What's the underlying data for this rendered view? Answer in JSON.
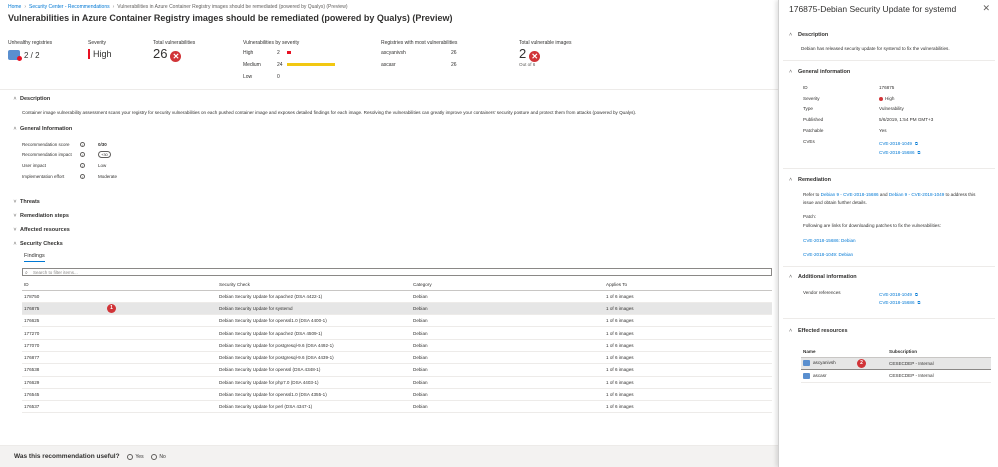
{
  "breadcrumb": {
    "items": [
      "Home",
      "Security Center - Recommendations",
      "Vulnerabilities in Azure Container Registry images should be remediated (powered by Qualys) (Preview)"
    ]
  },
  "page": {
    "title": "Vulnerabilities in Azure Container Registry images should be remediated (powered by Qualys) (Preview)",
    "more": "..."
  },
  "summary": {
    "unhealthy_label": "Unhealthy registries",
    "unhealthy_value": "2 / 2",
    "severity_label": "Severity",
    "severity_value": "High",
    "total_vuln_label": "Total vulnerabilities",
    "total_vuln_value": "26",
    "by_severity_label": "Vulnerabilities by severity",
    "by_severity": [
      {
        "label": "High",
        "count": "2",
        "fraction": 0.083,
        "color": "#e81123"
      },
      {
        "label": "Medium",
        "count": "24",
        "fraction": 1.0,
        "color": "#f2c811"
      },
      {
        "label": "Low",
        "count": "0",
        "fraction": 0,
        "color": "#8a8886"
      }
    ],
    "registries_label": "Registries with most vulnerabilities",
    "registries": [
      {
        "name": "ascyanivsh",
        "count": "26"
      },
      {
        "name": "ascasr",
        "count": "26"
      }
    ],
    "vuln_images_label": "Total vulnerable images",
    "vuln_images_value": "2",
    "vuln_images_sub": "Out of 6"
  },
  "sections": {
    "description": "Description",
    "description_text": "Container image vulnerability assessment scans your registry for security vulnerabilities on each pushed container image and exposes detailed findings for each image. Resolving the vulnerabilities can greatly improve your containers' security posture and protect them from attacks (powered by Qualys).",
    "general": "General Information",
    "threats": "Threats",
    "remediation": "Remediation steps",
    "affected": "Affected resources",
    "checks": "Security Checks"
  },
  "general_info": [
    {
      "label": "Recommendation score",
      "value": "0/30"
    },
    {
      "label": "Recommendation impact",
      "value": "+30"
    },
    {
      "label": "User impact",
      "value": "Low"
    },
    {
      "label": "Implementation effort",
      "value": "Moderate"
    }
  ],
  "findings": {
    "tab": "Findings",
    "filter_placeholder": "Search to filter items...",
    "columns": [
      "ID",
      "Security Check",
      "Category",
      "Applies To"
    ],
    "step_marker": "1",
    "rows": [
      {
        "id": "178750",
        "check": "Debian Security Update for apache2 (DSA 4422-1)",
        "category": "Debian",
        "applies": "1 of 6 images"
      },
      {
        "id": "176875",
        "check": "Debian Security Update for systemd",
        "category": "Debian",
        "applies": "1 of 6 images"
      },
      {
        "id": "176625",
        "check": "Debian Security Update for openssl1.0 (DSA 4400-1)",
        "category": "Debian",
        "applies": "1 of 6 images"
      },
      {
        "id": "177270",
        "check": "Debian Security Update for apache2 (DSA 4509-1)",
        "category": "Debian",
        "applies": "1 of 6 images"
      },
      {
        "id": "177070",
        "check": "Debian Security Update for postgresql-9.6 (DSA 4492-1)",
        "category": "Debian",
        "applies": "1 of 6 images"
      },
      {
        "id": "176877",
        "check": "Debian Security Update for postgresql-9.6 (DSA 4439-1)",
        "category": "Debian",
        "applies": "1 of 6 images"
      },
      {
        "id": "176538",
        "check": "Debian Security Update for openssl (DSA 4348-1)",
        "category": "Debian",
        "applies": "1 of 6 images"
      },
      {
        "id": "176629",
        "check": "Debian Security Update for php7.0 (DSA 4403-1)",
        "category": "Debian",
        "applies": "1 of 6 images"
      },
      {
        "id": "176545",
        "check": "Debian Security Update for openssl1.0 (DSA 4355-1)",
        "category": "Debian",
        "applies": "1 of 6 images"
      },
      {
        "id": "176537",
        "check": "Debian Security Update for perl (DSA 4347-1)",
        "category": "Debian",
        "applies": "1 of 6 images"
      }
    ]
  },
  "feedback": {
    "question": "Was this recommendation useful?",
    "yes": "Yes",
    "no": "No"
  },
  "detail": {
    "title": "176875-Debian Security Update for systemd",
    "close": "✕",
    "description_header": "Description",
    "description_text": "Debian has released security update for systemd to fix the vulnerabilities.",
    "general_header": "General information",
    "general": [
      {
        "label": "ID",
        "value": "176875"
      },
      {
        "label": "Severity",
        "value": "High"
      },
      {
        "label": "Type",
        "value": "Vulnerability"
      },
      {
        "label": "Published",
        "value": "5/6/2019, 1:54 PM GMT+3"
      },
      {
        "label": "Patchable",
        "value": "Yes"
      }
    ],
    "cves_label": "CVEs",
    "cves": [
      "CVE-2018-1049",
      "CVE-2018-15686"
    ],
    "remediation_header": "Remediation",
    "rem_refer": "Refer to",
    "rem_link1": "Debian 9 - CVE-2018-15686",
    "rem_and": "and",
    "rem_link2": "Debian 9 - CVE-2018-1049",
    "rem_to": "to address this",
    "rem_line2": "issue and obtain further details.",
    "patch_label": "Patch:",
    "patch_text": "Following are links for downloading patches to fix the vulnerabilities:",
    "patch_links": [
      "CVE-2018-15686: Debian",
      "CVE-2018-1049: Debian"
    ],
    "additional_header": "Additional information",
    "vendor_label": "Vendor references",
    "vendor_refs": [
      "CVE-2018-1049",
      "CVE-2018-15686"
    ],
    "affected_header": "Effected resources",
    "res_columns": [
      "Name",
      "Subscription"
    ],
    "step_marker": "2",
    "resources": [
      {
        "name": "ascyanivsh",
        "subscription": "CESECDEP - Internal"
      },
      {
        "name": "ascasr",
        "subscription": "CESECDEP - Internal"
      }
    ]
  }
}
